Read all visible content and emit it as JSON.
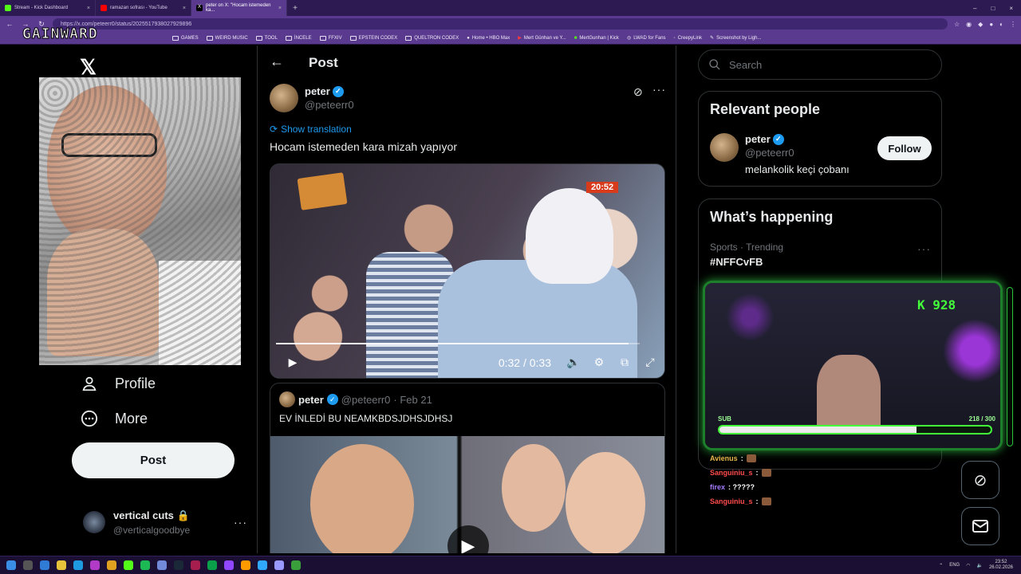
{
  "browser": {
    "tabs": [
      {
        "title": "Stream - Kick Dashboard",
        "fav_color": "#53fc18",
        "active": false
      },
      {
        "title": "ramazan sofrası - YouTube",
        "fav_color": "#ff0000",
        "active": false
      },
      {
        "title": "peter on X: \"Hocam istemeden ka...",
        "fav_color": "#000000",
        "active": true
      }
    ],
    "new_tab": "+",
    "url": "https://x.com/peteerr0/status/2025517938027929896",
    "window_controls": [
      "–",
      "□",
      "×"
    ],
    "bookmarks": [
      "GAMES",
      "WEIRD MUSIC",
      "TOOL",
      "İNCELE",
      "FFXIV",
      "EPSTEIN CODEX",
      "QUELTRON CODEX",
      "Home • HBO Max",
      "Mert Günhan ve Y...",
      "MertGunhan | Kick",
      "LWAD for Fans",
      "CreepyLink",
      "Screenshot by Ligh..."
    ]
  },
  "overlay_logo": "GAINWARD",
  "left_nav": {
    "x_logo": "𝕏",
    "items": [
      {
        "label": "Profile",
        "icon": "person-icon"
      },
      {
        "label": "More",
        "icon": "more-circle-icon"
      }
    ],
    "post_button": "Post",
    "account": {
      "display_name": "vertical cuts 🔒",
      "handle": "@verticalgoodbye",
      "menu": "···"
    }
  },
  "post_view": {
    "header_title": "Post",
    "back": "←",
    "author": {
      "display_name": "peter",
      "handle": "@peteerr0",
      "verified": true
    },
    "translate_label": "Show translation",
    "text": "Hocam istemeden kara mizah yapıyor",
    "video": {
      "timestamp_overlay": "20:52",
      "time": "0:32 / 0:33",
      "progress": 0.97
    },
    "quoted": {
      "display_name": "peter",
      "handle": "@peteerr0",
      "date": "· Feb 21",
      "text": "EV İNLEDİ BU NEAMKBDSJDHSJDHSJ"
    }
  },
  "sidebar": {
    "search_placeholder": "Search",
    "relevant_people": {
      "title": "Relevant people",
      "person": {
        "display_name": "peter",
        "handle": "@peteerr0",
        "bio": "melankolik keçi çobanı",
        "follow_label": "Follow"
      }
    },
    "happening": {
      "title": "What’s happening",
      "trend_context": "Sports · Trending",
      "trend_name": "#NFFCvFB"
    }
  },
  "stream_overlay": {
    "kick_count": "K 928",
    "sub_label": "SUB",
    "sub_count": "218  / 300",
    "sub_progress": 0.727,
    "chat": [
      {
        "user": "Avienus",
        "color": "#e8b64a",
        "msg": ":",
        "emote": true
      },
      {
        "user": "Sanguiniu_s",
        "color": "#ff4b4b",
        "msg": ":",
        "emote": true
      },
      {
        "user": "firex",
        "color": "#a57bff",
        "msg": ": ?????",
        "emote": false
      },
      {
        "user": "Sanguiniu_s",
        "color": "#ff4b4b",
        "msg": ":",
        "emote": true
      }
    ]
  },
  "taskbar": {
    "lang": "ENG",
    "time": "23:52",
    "date": "26.02.2026"
  },
  "colors": {
    "accent": "#1d9bf0",
    "browser_purple": "#5a3a8e",
    "kick_green": "#53fc18"
  }
}
